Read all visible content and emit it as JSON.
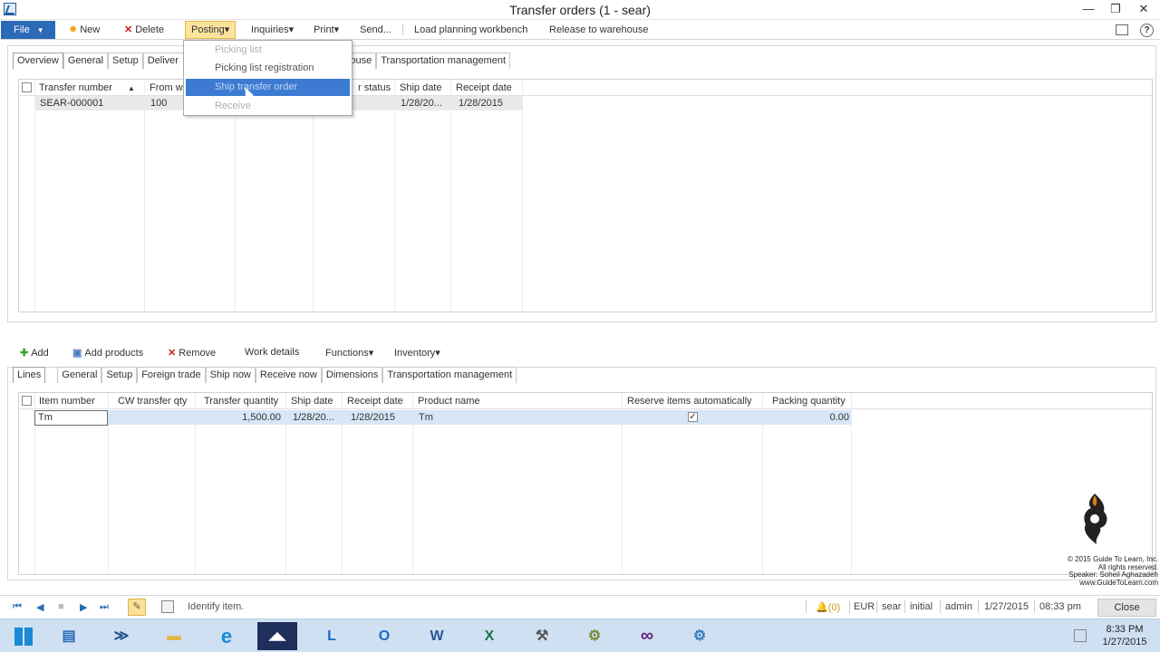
{
  "window": {
    "title": "Transfer orders (1 - sear)",
    "min": "—",
    "max": "❐",
    "close": "✕"
  },
  "action_pane": {
    "file": "File",
    "file_caret": "▼",
    "new": "New",
    "new_icon": "✸",
    "delete": "Delete",
    "delete_icon": "✕",
    "posting": "Posting▾",
    "inquiries": "Inquiries▾",
    "print": "Print▾",
    "send": "Send...",
    "load_planning_workbench": "Load planning workbench",
    "release_to_warehouse": "Release to warehouse",
    "help": "?"
  },
  "posting_menu": {
    "items": [
      {
        "label": "Picking list",
        "state": "disabled"
      },
      {
        "label": "Picking list registration",
        "state": "enabled"
      },
      {
        "label": "Ship transfer order",
        "state": "highlighted"
      },
      {
        "label": "Receive",
        "state": "disabled"
      }
    ]
  },
  "upper": {
    "tabs": [
      "Overview",
      "General",
      "Setup",
      "Deliver",
      "To warehouse",
      "Transportation management"
    ],
    "columns": [
      "Transfer number",
      "From w",
      "r status",
      "Ship date",
      "Receipt date"
    ],
    "sort_icon": "▲",
    "rows": [
      {
        "transfer_number": "SEAR-000001",
        "from_warehouse": "100",
        "ship_date": "1/28/20...",
        "receipt_date": "1/28/2015"
      }
    ]
  },
  "lines_toolbar": {
    "add": "Add",
    "add_icon": "✚",
    "add_products": "Add products",
    "add_products_icon": "▣",
    "remove": "Remove",
    "remove_icon": "✕",
    "work_details": "Work details",
    "functions": "Functions▾",
    "inventory": "Inventory▾"
  },
  "lower": {
    "tabs": [
      "Lines",
      "General",
      "Setup",
      "Foreign trade",
      "Ship now",
      "Receive now",
      "Dimensions",
      "Transportation management"
    ],
    "columns": [
      "Item number",
      "CW transfer qty",
      "Transfer quantity",
      "Ship date",
      "Receipt date",
      "Product name",
      "Reserve items automatically",
      "Packing quantity"
    ],
    "rows": [
      {
        "item_number": "Tm",
        "cw_transfer_qty": "",
        "transfer_quantity": "1,500.00",
        "ship_date": "1/28/20...",
        "receipt_date": "1/28/2015",
        "product_name": "Tm",
        "reserve_check": "✓",
        "packing_quantity": "0.00"
      }
    ]
  },
  "watermark": {
    "line1": "© 2015 Guide To Learn, Inc.",
    "line2": "All rights reserved.",
    "line3": "Speaker: Soheil Aghazadeh",
    "line4": "www.GuideToLearn.com"
  },
  "status_bar": {
    "nav_first": "⏮",
    "nav_prev": "◀",
    "nav_stop": "■",
    "nav_next": "▶",
    "nav_last": "⏭",
    "edit_icon": "✎",
    "text": "Identify item.",
    "bell": "🔔(0)",
    "currency": "EUR",
    "company": "sear",
    "layer": "initial",
    "user": "admin",
    "date": "1/27/2015",
    "time": "08:33 pm",
    "close": "Close"
  },
  "taskbar": {
    "apps": [
      "File Explorer",
      "PowerShell",
      "Folders",
      "Internet Explorer",
      "Dynamics AX",
      "Lync",
      "Outlook",
      "Word",
      "Excel",
      "Tools",
      "Network",
      "Visual Studio",
      "Search"
    ],
    "glyphs": [
      "▤",
      "≫",
      "▬",
      "e",
      "◢◣",
      "L",
      "O",
      "W",
      "X",
      "⚒",
      "⚙",
      "∞",
      "⚙"
    ],
    "clock_time": "8:33 PM",
    "clock_date": "1/27/2015"
  },
  "colors": {
    "accent": "#2a6ab7",
    "posting_highlight": "#fde49c",
    "menu_highlight": "#3d7bd2",
    "row_selected": "#d7e7f7"
  }
}
